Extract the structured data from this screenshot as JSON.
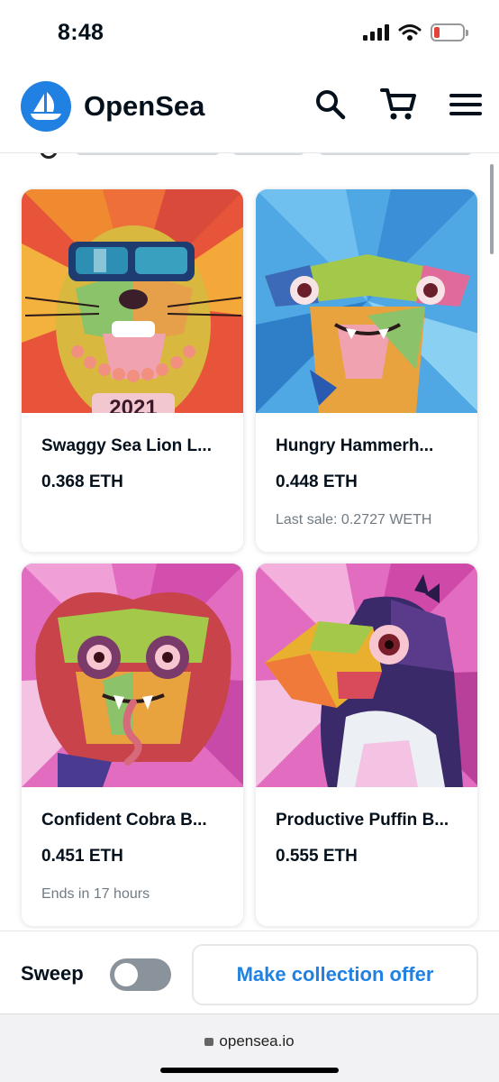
{
  "status_bar": {
    "time": "8:48"
  },
  "header": {
    "brand": "OpenSea"
  },
  "cards": [
    {
      "name": "Swaggy Sea Lion L...",
      "price": "0.368 ETH",
      "sub": ""
    },
    {
      "name": "Hungry Hammerh...",
      "price": "0.448 ETH",
      "sub": "Last sale: 0.2727 WETH"
    },
    {
      "name": "Confident Cobra B...",
      "price": "0.451 ETH",
      "sub": "Ends in 17 hours"
    },
    {
      "name": "Productive Puffin B...",
      "price": "0.555 ETH",
      "sub": ""
    }
  ],
  "bottom_bar": {
    "sweep_label": "Sweep",
    "sweep_on": false,
    "offer_button": "Make collection offer"
  },
  "browser": {
    "url": "opensea.io"
  },
  "colors": {
    "accent": "#2081e2",
    "text": "#04111d",
    "muted": "#707a83"
  },
  "icons": [
    "opensea-logo-icon",
    "search-icon",
    "cart-icon",
    "hamburger-menu-icon",
    "lock-icon",
    "signal-icon",
    "wifi-icon",
    "battery-icon"
  ]
}
